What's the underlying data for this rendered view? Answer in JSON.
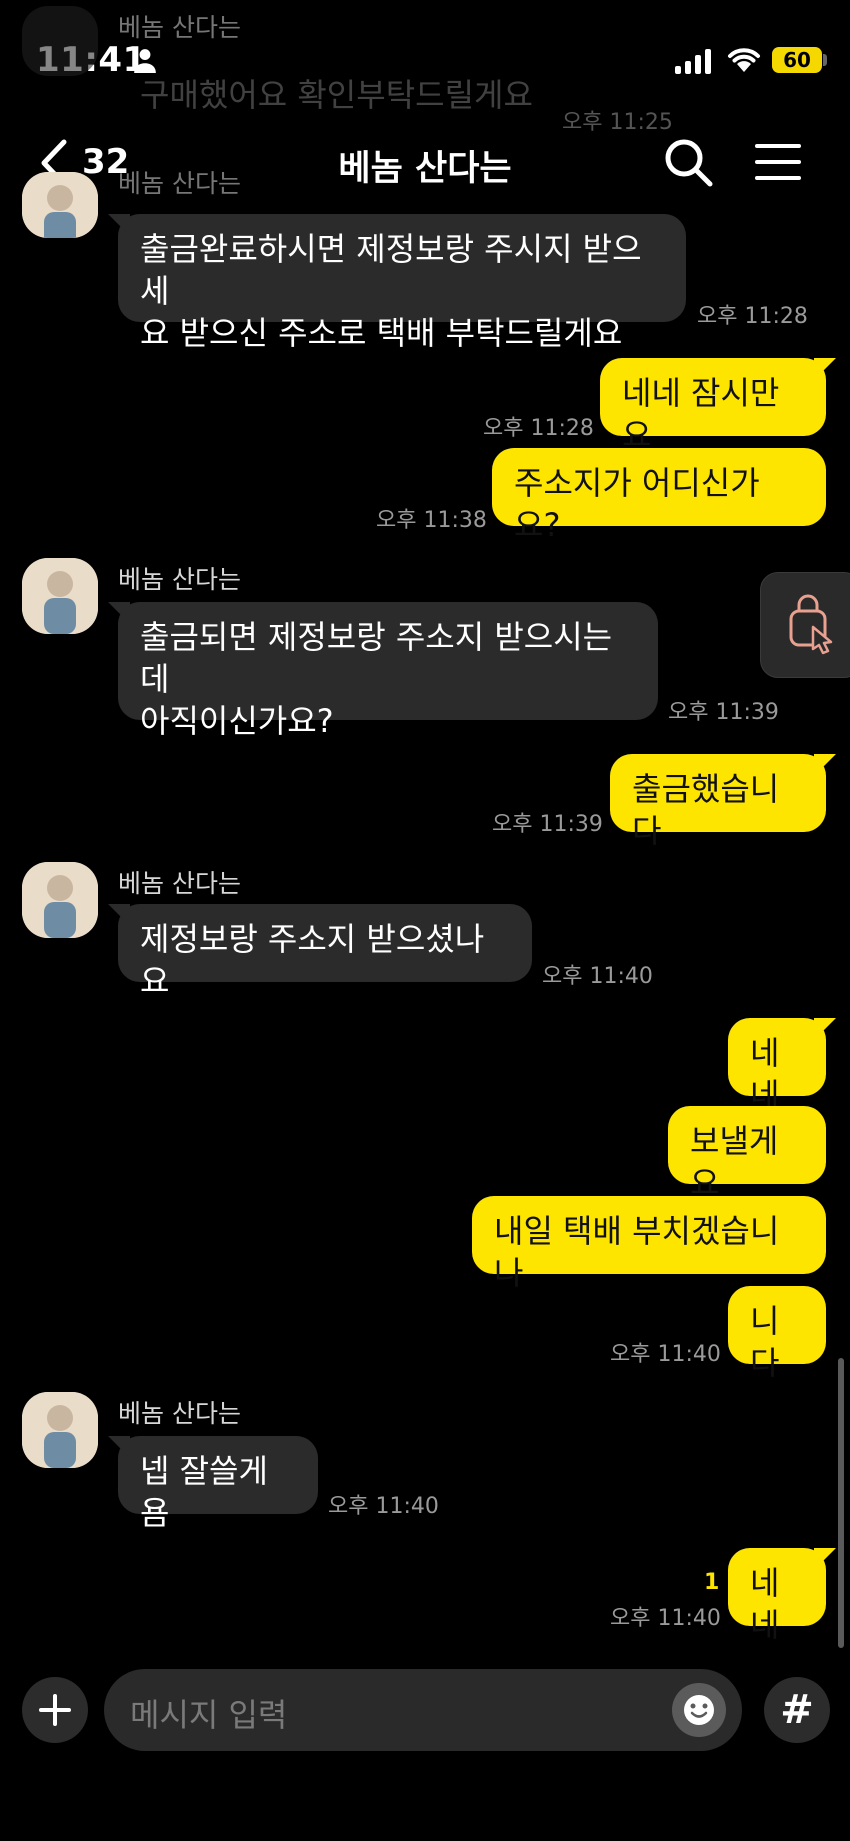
{
  "status_bar": {
    "time": "11:41",
    "battery": "60"
  },
  "scrolled_behind": {
    "sender": "베놈 산다는",
    "message": "구매했어요 확인부탁드릴게요",
    "time": "오후 11:25",
    "sender2": "베놈 산다는"
  },
  "header": {
    "unread_count": "32",
    "title": "베놈 산다는"
  },
  "messages": [
    {
      "direction": "in",
      "text": "출금완료하시면 제정보랑 주시지 받으세\n요 받으신 주소로 택배 부탁드릴게요",
      "time": "오후 11:28"
    },
    {
      "direction": "out",
      "text": "네네 잠시만요",
      "time": "오후 11:28"
    },
    {
      "direction": "out",
      "text": "주소지가 어디신가요?",
      "time": "오후 11:38"
    },
    {
      "direction": "in",
      "sender": "베놈 산다는",
      "text": "출금되면 제정보랑 주소지 받으시는데\n아직이신가요?",
      "time": "오후 11:39"
    },
    {
      "direction": "out",
      "text": "출금했습니다",
      "time": "오후 11:39"
    },
    {
      "direction": "in",
      "sender": "베놈 산다는",
      "text": "제정보랑 주소지 받으셨나요",
      "time": "오후 11:40"
    },
    {
      "direction": "out",
      "text": "네네"
    },
    {
      "direction": "out",
      "text": "보낼게요"
    },
    {
      "direction": "out",
      "text": "내일 택배 부치겠습니나"
    },
    {
      "direction": "out",
      "text": "니다",
      "time": "오후 11:40"
    },
    {
      "direction": "in",
      "sender": "베놈 산다는",
      "text": "넵 잘쓸게욤",
      "time": "오후 11:40"
    },
    {
      "direction": "out",
      "text": "네네",
      "time": "오후 11:40",
      "unread": "1"
    }
  ],
  "input": {
    "placeholder": "메시지 입력",
    "hash_label": "#"
  },
  "colors": {
    "background": "#000000",
    "outgoing_bubble": "#fee500",
    "incoming_bubble": "#2b2b2b"
  }
}
